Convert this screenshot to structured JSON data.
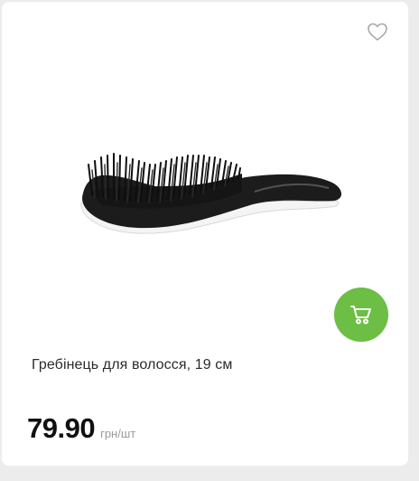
{
  "product": {
    "name": "Гребінець для волосся, 19 см",
    "price": "79.90",
    "unit": "грн/шт",
    "image_icon": "hair-brush-image",
    "favorite_icon": "heart-icon",
    "cart_icon": "cart-icon"
  },
  "colors": {
    "accent": "#6cbe45",
    "card_bg": "#ffffff",
    "page_bg": "#ececec"
  }
}
